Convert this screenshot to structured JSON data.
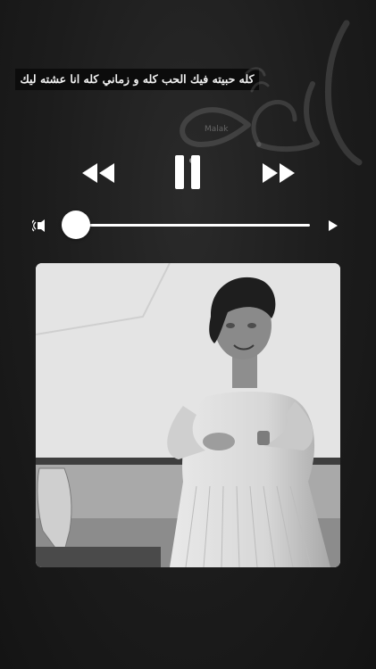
{
  "lyrics": {
    "text": "كله حبيته فيك الحب كله و زماني كله انا عشته ليك"
  },
  "watermark": {
    "text": "Malak"
  },
  "player": {
    "controls": {
      "rewind_icon": "rewind-icon",
      "pause_icon": "pause-icon",
      "forward_icon": "fast-forward-icon"
    },
    "progress": 0.0,
    "volume_icon": "speaker-icon",
    "end_icon": "play-small-icon"
  },
  "artwork": {
    "description_icon": "album-artwork-photo"
  },
  "colors": {
    "background": "#1c1c1c",
    "foreground": "#ffffff",
    "lyrics_bg": "#0c0c0c"
  }
}
